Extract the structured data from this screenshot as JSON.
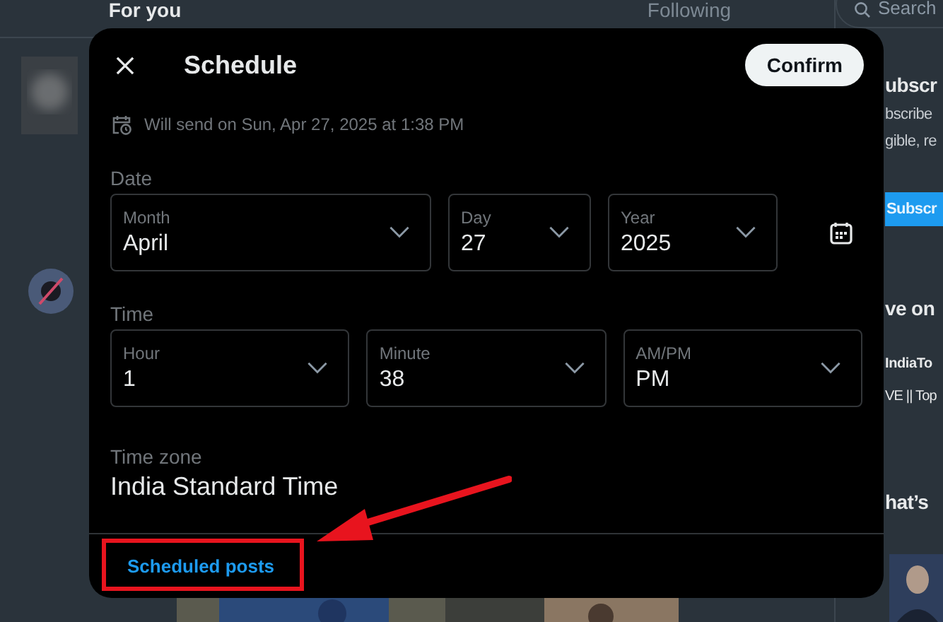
{
  "feed_tabs": [
    {
      "label": "For you",
      "selected": true
    },
    {
      "label": "Following",
      "selected": false
    }
  ],
  "search": {
    "placeholder": "Search"
  },
  "sidebar": {
    "premium_title": "ubscr",
    "premium_text": "bscribe\ngible, re",
    "premium_button": "Subscr",
    "live_title": "ve on",
    "live_channel": "IndiaTo",
    "live_text": "VE || Top",
    "trends_title": "hat’s"
  },
  "dialog": {
    "title": "Schedule",
    "confirm": "Confirm",
    "summary": "Will send on Sun, Apr 27, 2025 at 1:38 PM",
    "date_label": "Date",
    "date_fields": [
      {
        "label": "Month",
        "value": "April"
      },
      {
        "label": "Day",
        "value": "27"
      },
      {
        "label": "Year",
        "value": "2025"
      }
    ],
    "time_label": "Time",
    "time_fields": [
      {
        "label": "Hour",
        "value": "1"
      },
      {
        "label": "Minute",
        "value": "38"
      },
      {
        "label": "AM/PM",
        "value": "PM"
      }
    ],
    "time_zone_label": "Time zone",
    "time_zone": "India Standard Time",
    "footer_link": "Scheduled posts"
  }
}
